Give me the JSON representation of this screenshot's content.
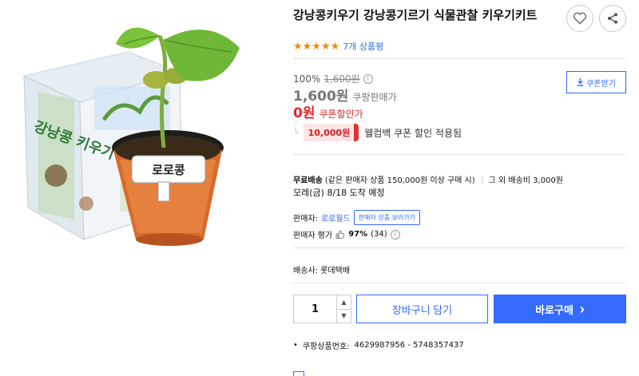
{
  "product": {
    "title": "강낭콩키우기 강낭콩기르기 식물관찰 키우기키트",
    "rating_stars": "★★★★★",
    "review_count": "7개 상품평",
    "label_on_plant": "로로콩"
  },
  "price": {
    "discount_rate": "100%",
    "original_price": "1,600원",
    "sale_price": "1,600원",
    "sale_label": "쿠팡판매가",
    "coupon_price": "0원",
    "coupon_label": "쿠폰할인가",
    "coupon_button": "쿠폰받기"
  },
  "cashback": {
    "amount": "10,000원",
    "text": "웰컴백 쿠폰 할인 적용됨"
  },
  "shipping": {
    "free": "무료배송",
    "condition": "(같은 판매자 상품 150,000원 이상 구매 시)",
    "other": "그 외 배송비 3,000원",
    "arrival": "모레(금) 8/18 도착 예정"
  },
  "seller": {
    "label": "판매자:",
    "name": "로로월드",
    "view_button": "판매자 상품 보러가기",
    "rating_label": "판매자 평가",
    "rating_percent": "97%",
    "rating_count": "(34)"
  },
  "delivery": {
    "carrier": "배송사: 롯데택배"
  },
  "purchase": {
    "quantity": "1",
    "cart_button": "장바구니 담기",
    "buy_button": "바로구매",
    "buy_arrow": "›"
  },
  "product_number": {
    "label": "쿠팡상품번호:",
    "value": "4629987956 - 5748357437"
  },
  "colors": {
    "accent": "#346aff",
    "price_red": "#e52528",
    "star_orange": "#f48a00"
  }
}
